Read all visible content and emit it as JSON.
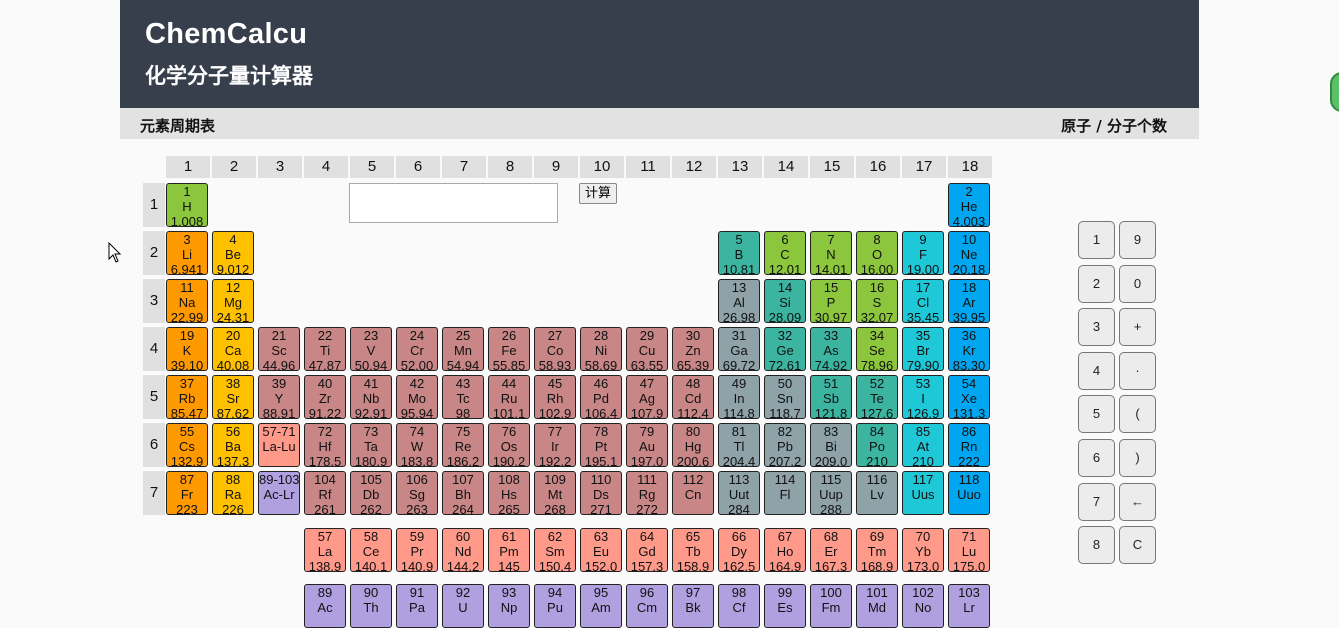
{
  "header": {
    "brand": "ChemCalcu",
    "subtitle": "化学分子量计算器"
  },
  "subbar": {
    "left": "元素周期表",
    "right": "原子 / 分子个数"
  },
  "group_numbers": [
    "1",
    "2",
    "3",
    "4",
    "5",
    "6",
    "7",
    "8",
    "9",
    "10",
    "11",
    "12",
    "13",
    "14",
    "15",
    "16",
    "17",
    "18"
  ],
  "period_numbers": [
    "1",
    "2",
    "3",
    "4",
    "5",
    "6",
    "7"
  ],
  "formula_input": {
    "value": "",
    "placeholder": ""
  },
  "calc_button": "计算",
  "colors": {
    "alkali": "#ff9900",
    "alkaline": "#ffc000",
    "transition": "#c88686",
    "lanthanide": "#ff9a8a",
    "actinide": "#b0a0e0",
    "post": "#8fa2a8",
    "metalloid": "#3bb5a0",
    "nonmetal": "#8bc63c",
    "halogen": "#1ec8d6",
    "noble": "#00a6ef",
    "header_bg": "#373f4c"
  },
  "elements": [
    {
      "n": "1",
      "s": "H",
      "m": "1.008",
      "c": "nonmetal",
      "r": 1,
      "g": 1
    },
    {
      "n": "2",
      "s": "He",
      "m": "4.003",
      "c": "noble",
      "r": 1,
      "g": 18
    },
    {
      "n": "3",
      "s": "Li",
      "m": "6.941",
      "c": "alkali",
      "r": 2,
      "g": 1
    },
    {
      "n": "4",
      "s": "Be",
      "m": "9.012",
      "c": "alkaline",
      "r": 2,
      "g": 2
    },
    {
      "n": "5",
      "s": "B",
      "m": "10.81",
      "c": "metalloid",
      "r": 2,
      "g": 13
    },
    {
      "n": "6",
      "s": "C",
      "m": "12.01",
      "c": "nonmetal",
      "r": 2,
      "g": 14
    },
    {
      "n": "7",
      "s": "N",
      "m": "14.01",
      "c": "nonmetal",
      "r": 2,
      "g": 15
    },
    {
      "n": "8",
      "s": "O",
      "m": "16.00",
      "c": "nonmetal",
      "r": 2,
      "g": 16
    },
    {
      "n": "9",
      "s": "F",
      "m": "19.00",
      "c": "halogen",
      "r": 2,
      "g": 17
    },
    {
      "n": "10",
      "s": "Ne",
      "m": "20.18",
      "c": "noble",
      "r": 2,
      "g": 18
    },
    {
      "n": "11",
      "s": "Na",
      "m": "22.99",
      "c": "alkali",
      "r": 3,
      "g": 1
    },
    {
      "n": "12",
      "s": "Mg",
      "m": "24.31",
      "c": "alkaline",
      "r": 3,
      "g": 2
    },
    {
      "n": "13",
      "s": "Al",
      "m": "26.98",
      "c": "post",
      "r": 3,
      "g": 13
    },
    {
      "n": "14",
      "s": "Si",
      "m": "28.09",
      "c": "metalloid",
      "r": 3,
      "g": 14
    },
    {
      "n": "15",
      "s": "P",
      "m": "30.97",
      "c": "nonmetal",
      "r": 3,
      "g": 15
    },
    {
      "n": "16",
      "s": "S",
      "m": "32.07",
      "c": "nonmetal",
      "r": 3,
      "g": 16
    },
    {
      "n": "17",
      "s": "Cl",
      "m": "35.45",
      "c": "halogen",
      "r": 3,
      "g": 17
    },
    {
      "n": "18",
      "s": "Ar",
      "m": "39.95",
      "c": "noble",
      "r": 3,
      "g": 18
    },
    {
      "n": "19",
      "s": "K",
      "m": "39.10",
      "c": "alkali",
      "r": 4,
      "g": 1
    },
    {
      "n": "20",
      "s": "Ca",
      "m": "40.08",
      "c": "alkaline",
      "r": 4,
      "g": 2
    },
    {
      "n": "21",
      "s": "Sc",
      "m": "44.96",
      "c": "transition",
      "r": 4,
      "g": 3
    },
    {
      "n": "22",
      "s": "Ti",
      "m": "47.87",
      "c": "transition",
      "r": 4,
      "g": 4
    },
    {
      "n": "23",
      "s": "V",
      "m": "50.94",
      "c": "transition",
      "r": 4,
      "g": 5
    },
    {
      "n": "24",
      "s": "Cr",
      "m": "52.00",
      "c": "transition",
      "r": 4,
      "g": 6
    },
    {
      "n": "25",
      "s": "Mn",
      "m": "54.94",
      "c": "transition",
      "r": 4,
      "g": 7
    },
    {
      "n": "26",
      "s": "Fe",
      "m": "55.85",
      "c": "transition",
      "r": 4,
      "g": 8
    },
    {
      "n": "27",
      "s": "Co",
      "m": "58.93",
      "c": "transition",
      "r": 4,
      "g": 9
    },
    {
      "n": "28",
      "s": "Ni",
      "m": "58.69",
      "c": "transition",
      "r": 4,
      "g": 10
    },
    {
      "n": "29",
      "s": "Cu",
      "m": "63.55",
      "c": "transition",
      "r": 4,
      "g": 11
    },
    {
      "n": "30",
      "s": "Zn",
      "m": "65.39",
      "c": "transition",
      "r": 4,
      "g": 12
    },
    {
      "n": "31",
      "s": "Ga",
      "m": "69.72",
      "c": "post",
      "r": 4,
      "g": 13
    },
    {
      "n": "32",
      "s": "Ge",
      "m": "72.61",
      "c": "metalloid",
      "r": 4,
      "g": 14
    },
    {
      "n": "33",
      "s": "As",
      "m": "74.92",
      "c": "metalloid",
      "r": 4,
      "g": 15
    },
    {
      "n": "34",
      "s": "Se",
      "m": "78.96",
      "c": "nonmetal",
      "r": 4,
      "g": 16
    },
    {
      "n": "35",
      "s": "Br",
      "m": "79.90",
      "c": "halogen",
      "r": 4,
      "g": 17
    },
    {
      "n": "36",
      "s": "Kr",
      "m": "83.30",
      "c": "noble",
      "r": 4,
      "g": 18
    },
    {
      "n": "37",
      "s": "Rb",
      "m": "85.47",
      "c": "alkali",
      "r": 5,
      "g": 1
    },
    {
      "n": "38",
      "s": "Sr",
      "m": "87.62",
      "c": "alkaline",
      "r": 5,
      "g": 2
    },
    {
      "n": "39",
      "s": "Y",
      "m": "88.91",
      "c": "transition",
      "r": 5,
      "g": 3
    },
    {
      "n": "40",
      "s": "Zr",
      "m": "91.22",
      "c": "transition",
      "r": 5,
      "g": 4
    },
    {
      "n": "41",
      "s": "Nb",
      "m": "92.91",
      "c": "transition",
      "r": 5,
      "g": 5
    },
    {
      "n": "42",
      "s": "Mo",
      "m": "95.94",
      "c": "transition",
      "r": 5,
      "g": 6
    },
    {
      "n": "43",
      "s": "Tc",
      "m": "98",
      "c": "transition",
      "r": 5,
      "g": 7
    },
    {
      "n": "44",
      "s": "Ru",
      "m": "101.1",
      "c": "transition",
      "r": 5,
      "g": 8
    },
    {
      "n": "45",
      "s": "Rh",
      "m": "102.9",
      "c": "transition",
      "r": 5,
      "g": 9
    },
    {
      "n": "46",
      "s": "Pd",
      "m": "106.4",
      "c": "transition",
      "r": 5,
      "g": 10
    },
    {
      "n": "47",
      "s": "Ag",
      "m": "107.9",
      "c": "transition",
      "r": 5,
      "g": 11
    },
    {
      "n": "48",
      "s": "Cd",
      "m": "112.4",
      "c": "transition",
      "r": 5,
      "g": 12
    },
    {
      "n": "49",
      "s": "In",
      "m": "114.8",
      "c": "post",
      "r": 5,
      "g": 13
    },
    {
      "n": "50",
      "s": "Sn",
      "m": "118.7",
      "c": "post",
      "r": 5,
      "g": 14
    },
    {
      "n": "51",
      "s": "Sb",
      "m": "121.8",
      "c": "metalloid",
      "r": 5,
      "g": 15
    },
    {
      "n": "52",
      "s": "Te",
      "m": "127.6",
      "c": "metalloid",
      "r": 5,
      "g": 16
    },
    {
      "n": "53",
      "s": "I",
      "m": "126.9",
      "c": "halogen",
      "r": 5,
      "g": 17
    },
    {
      "n": "54",
      "s": "Xe",
      "m": "131.3",
      "c": "noble",
      "r": 5,
      "g": 18
    },
    {
      "n": "55",
      "s": "Cs",
      "m": "132.9",
      "c": "alkali",
      "r": 6,
      "g": 1
    },
    {
      "n": "56",
      "s": "Ba",
      "m": "137.3",
      "c": "alkaline",
      "r": 6,
      "g": 2
    },
    {
      "n": "57-71",
      "s": "La-Lu",
      "m": "",
      "c": "lanthanide",
      "r": 6,
      "g": 3
    },
    {
      "n": "72",
      "s": "Hf",
      "m": "178.5",
      "c": "transition",
      "r": 6,
      "g": 4
    },
    {
      "n": "73",
      "s": "Ta",
      "m": "180.9",
      "c": "transition",
      "r": 6,
      "g": 5
    },
    {
      "n": "74",
      "s": "W",
      "m": "183.8",
      "c": "transition",
      "r": 6,
      "g": 6
    },
    {
      "n": "75",
      "s": "Re",
      "m": "186.2",
      "c": "transition",
      "r": 6,
      "g": 7
    },
    {
      "n": "76",
      "s": "Os",
      "m": "190.2",
      "c": "transition",
      "r": 6,
      "g": 8
    },
    {
      "n": "77",
      "s": "Ir",
      "m": "192.2",
      "c": "transition",
      "r": 6,
      "g": 9
    },
    {
      "n": "78",
      "s": "Pt",
      "m": "195.1",
      "c": "transition",
      "r": 6,
      "g": 10
    },
    {
      "n": "79",
      "s": "Au",
      "m": "197.0",
      "c": "transition",
      "r": 6,
      "g": 11
    },
    {
      "n": "80",
      "s": "Hg",
      "m": "200.6",
      "c": "transition",
      "r": 6,
      "g": 12
    },
    {
      "n": "81",
      "s": "Tl",
      "m": "204.4",
      "c": "post",
      "r": 6,
      "g": 13
    },
    {
      "n": "82",
      "s": "Pb",
      "m": "207.2",
      "c": "post",
      "r": 6,
      "g": 14
    },
    {
      "n": "83",
      "s": "Bi",
      "m": "209.0",
      "c": "post",
      "r": 6,
      "g": 15
    },
    {
      "n": "84",
      "s": "Po",
      "m": "210",
      "c": "metalloid",
      "r": 6,
      "g": 16
    },
    {
      "n": "85",
      "s": "At",
      "m": "210",
      "c": "halogen",
      "r": 6,
      "g": 17
    },
    {
      "n": "86",
      "s": "Rn",
      "m": "222",
      "c": "noble",
      "r": 6,
      "g": 18
    },
    {
      "n": "87",
      "s": "Fr",
      "m": "223",
      "c": "alkali",
      "r": 7,
      "g": 1
    },
    {
      "n": "88",
      "s": "Ra",
      "m": "226",
      "c": "alkaline",
      "r": 7,
      "g": 2
    },
    {
      "n": "89-103",
      "s": "Ac-Lr",
      "m": "",
      "c": "actinide",
      "r": 7,
      "g": 3
    },
    {
      "n": "104",
      "s": "Rf",
      "m": "261",
      "c": "transition",
      "r": 7,
      "g": 4
    },
    {
      "n": "105",
      "s": "Db",
      "m": "262",
      "c": "transition",
      "r": 7,
      "g": 5
    },
    {
      "n": "106",
      "s": "Sg",
      "m": "263",
      "c": "transition",
      "r": 7,
      "g": 6
    },
    {
      "n": "107",
      "s": "Bh",
      "m": "264",
      "c": "transition",
      "r": 7,
      "g": 7
    },
    {
      "n": "108",
      "s": "Hs",
      "m": "265",
      "c": "transition",
      "r": 7,
      "g": 8
    },
    {
      "n": "109",
      "s": "Mt",
      "m": "268",
      "c": "transition",
      "r": 7,
      "g": 9
    },
    {
      "n": "110",
      "s": "Ds",
      "m": "271",
      "c": "transition",
      "r": 7,
      "g": 10
    },
    {
      "n": "111",
      "s": "Rg",
      "m": "272",
      "c": "transition",
      "r": 7,
      "g": 11
    },
    {
      "n": "112",
      "s": "Cn",
      "m": "",
      "c": "transition",
      "r": 7,
      "g": 12
    },
    {
      "n": "113",
      "s": "Uut",
      "m": "284",
      "c": "post",
      "r": 7,
      "g": 13
    },
    {
      "n": "114",
      "s": "Fl",
      "m": "",
      "c": "post",
      "r": 7,
      "g": 14
    },
    {
      "n": "115",
      "s": "Uup",
      "m": "288",
      "c": "post",
      "r": 7,
      "g": 15
    },
    {
      "n": "116",
      "s": "Lv",
      "m": "",
      "c": "post",
      "r": 7,
      "g": 16
    },
    {
      "n": "117",
      "s": "Uus",
      "m": "",
      "c": "halogen",
      "r": 7,
      "g": 17
    },
    {
      "n": "118",
      "s": "Uuo",
      "m": "",
      "c": "noble",
      "r": 7,
      "g": 18
    },
    {
      "n": "57",
      "s": "La",
      "m": "138.9",
      "c": "lanthanide",
      "r": 9,
      "g": 4
    },
    {
      "n": "58",
      "s": "Ce",
      "m": "140.1",
      "c": "lanthanide",
      "r": 9,
      "g": 5
    },
    {
      "n": "59",
      "s": "Pr",
      "m": "140.9",
      "c": "lanthanide",
      "r": 9,
      "g": 6
    },
    {
      "n": "60",
      "s": "Nd",
      "m": "144.2",
      "c": "lanthanide",
      "r": 9,
      "g": 7
    },
    {
      "n": "61",
      "s": "Pm",
      "m": "145",
      "c": "lanthanide",
      "r": 9,
      "g": 8
    },
    {
      "n": "62",
      "s": "Sm",
      "m": "150.4",
      "c": "lanthanide",
      "r": 9,
      "g": 9
    },
    {
      "n": "63",
      "s": "Eu",
      "m": "152.0",
      "c": "lanthanide",
      "r": 9,
      "g": 10
    },
    {
      "n": "64",
      "s": "Gd",
      "m": "157.3",
      "c": "lanthanide",
      "r": 9,
      "g": 11
    },
    {
      "n": "65",
      "s": "Tb",
      "m": "158.9",
      "c": "lanthanide",
      "r": 9,
      "g": 12
    },
    {
      "n": "66",
      "s": "Dy",
      "m": "162.5",
      "c": "lanthanide",
      "r": 9,
      "g": 13
    },
    {
      "n": "67",
      "s": "Ho",
      "m": "164.9",
      "c": "lanthanide",
      "r": 9,
      "g": 14
    },
    {
      "n": "68",
      "s": "Er",
      "m": "167.3",
      "c": "lanthanide",
      "r": 9,
      "g": 15
    },
    {
      "n": "69",
      "s": "Tm",
      "m": "168.9",
      "c": "lanthanide",
      "r": 9,
      "g": 16
    },
    {
      "n": "70",
      "s": "Yb",
      "m": "173.0",
      "c": "lanthanide",
      "r": 9,
      "g": 17
    },
    {
      "n": "71",
      "s": "Lu",
      "m": "175.0",
      "c": "lanthanide",
      "r": 9,
      "g": 18
    },
    {
      "n": "89",
      "s": "Ac",
      "m": "",
      "c": "actinide",
      "r": 10,
      "g": 4
    },
    {
      "n": "90",
      "s": "Th",
      "m": "",
      "c": "actinide",
      "r": 10,
      "g": 5
    },
    {
      "n": "91",
      "s": "Pa",
      "m": "",
      "c": "actinide",
      "r": 10,
      "g": 6
    },
    {
      "n": "92",
      "s": "U",
      "m": "",
      "c": "actinide",
      "r": 10,
      "g": 7
    },
    {
      "n": "93",
      "s": "Np",
      "m": "",
      "c": "actinide",
      "r": 10,
      "g": 8
    },
    {
      "n": "94",
      "s": "Pu",
      "m": "",
      "c": "actinide",
      "r": 10,
      "g": 9
    },
    {
      "n": "95",
      "s": "Am",
      "m": "",
      "c": "actinide",
      "r": 10,
      "g": 10
    },
    {
      "n": "96",
      "s": "Cm",
      "m": "",
      "c": "actinide",
      "r": 10,
      "g": 11
    },
    {
      "n": "97",
      "s": "Bk",
      "m": "",
      "c": "actinide",
      "r": 10,
      "g": 12
    },
    {
      "n": "98",
      "s": "Cf",
      "m": "",
      "c": "actinide",
      "r": 10,
      "g": 13
    },
    {
      "n": "99",
      "s": "Es",
      "m": "",
      "c": "actinide",
      "r": 10,
      "g": 14
    },
    {
      "n": "100",
      "s": "Fm",
      "m": "",
      "c": "actinide",
      "r": 10,
      "g": 15
    },
    {
      "n": "101",
      "s": "Md",
      "m": "",
      "c": "actinide",
      "r": 10,
      "g": 16
    },
    {
      "n": "102",
      "s": "No",
      "m": "",
      "c": "actinide",
      "r": 10,
      "g": 17
    },
    {
      "n": "103",
      "s": "Lr",
      "m": "",
      "c": "actinide",
      "r": 10,
      "g": 18
    }
  ],
  "keypad": [
    {
      "label": "1",
      "name": "key-1"
    },
    {
      "label": "9",
      "name": "key-9"
    },
    {
      "label": "2",
      "name": "key-2"
    },
    {
      "label": "0",
      "name": "key-0"
    },
    {
      "label": "3",
      "name": "key-3"
    },
    {
      "label": "+",
      "name": "key-plus"
    },
    {
      "label": "4",
      "name": "key-4"
    },
    {
      "label": "·",
      "name": "key-dot"
    },
    {
      "label": "5",
      "name": "key-5"
    },
    {
      "label": "(",
      "name": "key-open-paren"
    },
    {
      "label": "6",
      "name": "key-6"
    },
    {
      "label": ")",
      "name": "key-close-paren"
    },
    {
      "label": "7",
      "name": "key-7"
    },
    {
      "label": "←",
      "name": "key-backspace"
    },
    {
      "label": "8",
      "name": "key-8"
    },
    {
      "label": "C",
      "name": "key-clear"
    }
  ]
}
